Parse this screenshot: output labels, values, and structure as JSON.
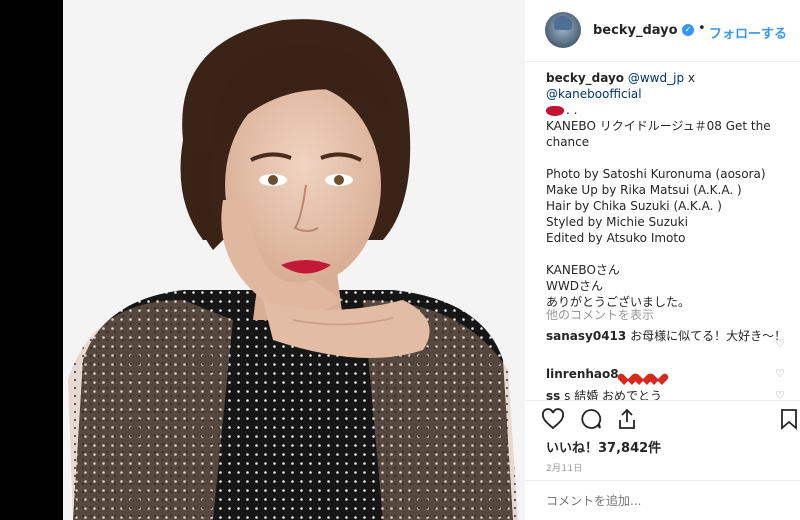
{
  "post": {
    "username": "becky_dayo",
    "verified_icon": "verified-badge-icon",
    "separator": "•",
    "follow_label": "フォローする"
  },
  "caption": {
    "username": "becky_dayo",
    "mention1": "@wwd_jp",
    "x": "x",
    "mention2": "@kaneboofficial",
    "tail": ". .",
    "lines": [
      "KANEBO リクイドルージュ＃08 Get the chance",
      "",
      "Photo by Satoshi Kuronuma (aosora)",
      "Make Up by Rika Matsui (A.K.A. )",
      "Hair by Chika Suzuki (A.K.A. )",
      "Styled by Michie Suzuki",
      "Edited by Atsuko Imoto",
      "",
      "KANEBOさん",
      "WWDさん",
      "ありがとうございました。"
    ]
  },
  "more_comments_label": "他のコメントを表示",
  "comments": [
    {
      "username": "sanasy0413",
      "text": "お母様に似てる！大好き〜！"
    },
    {
      "username": "linrenhao8",
      "text": ""
    },
    {
      "username": "ss",
      "text": "s 結婚 おめでとう"
    }
  ],
  "likes": "いいね！37,842件",
  "date": "2月11日",
  "add_comment_placeholder": "コメントを追加...",
  "colors": {
    "accent": "#3897f0",
    "text": "#262626",
    "muted": "#999999",
    "border": "#efefef"
  }
}
